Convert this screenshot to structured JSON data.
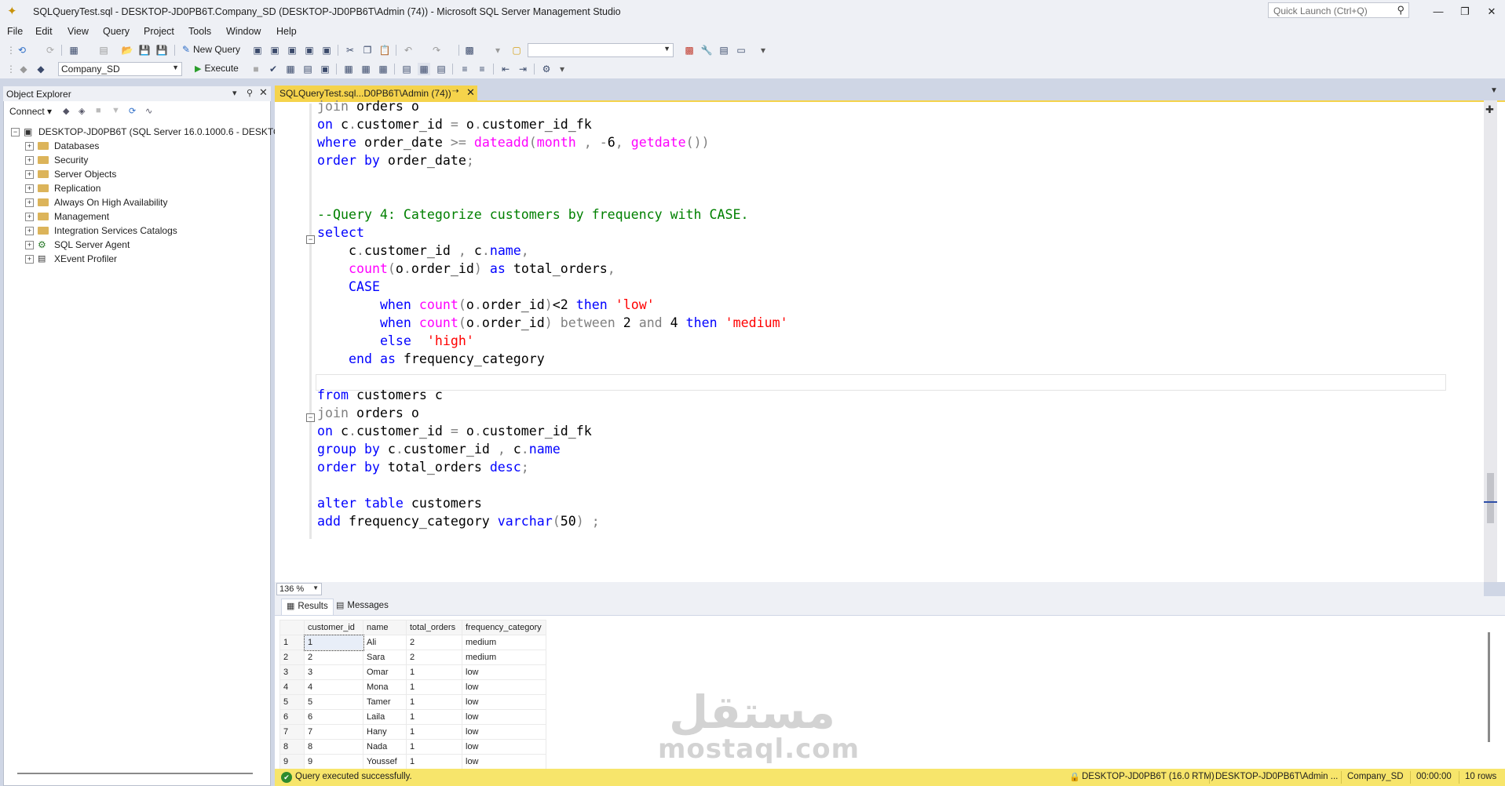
{
  "window": {
    "title": "SQLQueryTest.sql - DESKTOP-JD0PB6T.Company_SD (DESKTOP-JD0PB6T\\Admin (74)) - Microsoft SQL Server Management Studio",
    "quick_launch_placeholder": "Quick Launch (Ctrl+Q)"
  },
  "menu": [
    "File",
    "Edit",
    "View",
    "Query",
    "Project",
    "Tools",
    "Window",
    "Help"
  ],
  "toolbar": {
    "new_query_label": "New Query",
    "database": "Company_SD",
    "execute_label": "Execute"
  },
  "object_explorer": {
    "title": "Object Explorer",
    "connect_label": "Connect",
    "server": "DESKTOP-JD0PB6T (SQL Server 16.0.1000.6 - DESKTOP-J",
    "nodes": [
      "Databases",
      "Security",
      "Server Objects",
      "Replication",
      "Always On High Availability",
      "Management",
      "Integration Services Catalogs",
      "SQL Server Agent",
      "XEvent Profiler"
    ]
  },
  "editor": {
    "tab_label": "SQLQueryTest.sql...D0PB6T\\Admin (74))",
    "zoom": "136 %"
  },
  "results": {
    "tab_results": "Results",
    "tab_messages": "Messages",
    "columns": [
      "customer_id",
      "name",
      "total_orders",
      "frequency_category"
    ],
    "rows": [
      [
        "1",
        "1",
        "Ali",
        "2",
        "medium"
      ],
      [
        "2",
        "2",
        "Sara",
        "2",
        "medium"
      ],
      [
        "3",
        "3",
        "Omar",
        "1",
        "low"
      ],
      [
        "4",
        "4",
        "Mona",
        "1",
        "low"
      ],
      [
        "5",
        "5",
        "Tamer",
        "1",
        "low"
      ],
      [
        "6",
        "6",
        "Laila",
        "1",
        "low"
      ],
      [
        "7",
        "7",
        "Hany",
        "1",
        "low"
      ],
      [
        "8",
        "8",
        "Nada",
        "1",
        "low"
      ],
      [
        "9",
        "9",
        "Youssef",
        "1",
        "low"
      ]
    ]
  },
  "watermark": {
    "arabic": "مستقل",
    "latin": "mostaql.com"
  },
  "status": {
    "message": "Query executed successfully.",
    "server": "DESKTOP-JD0PB6T (16.0 RTM)",
    "user": "DESKTOP-JD0PB6T\\Admin ...",
    "database": "Company_SD",
    "elapsed": "00:00:00",
    "rows": "10 rows"
  },
  "colors": {
    "tab_active": "#f5d34b",
    "status_bar": "#f7e56b",
    "keyword": "#0000ff",
    "function": "#ff00ff",
    "string": "#ff0000",
    "comment": "#008000"
  }
}
